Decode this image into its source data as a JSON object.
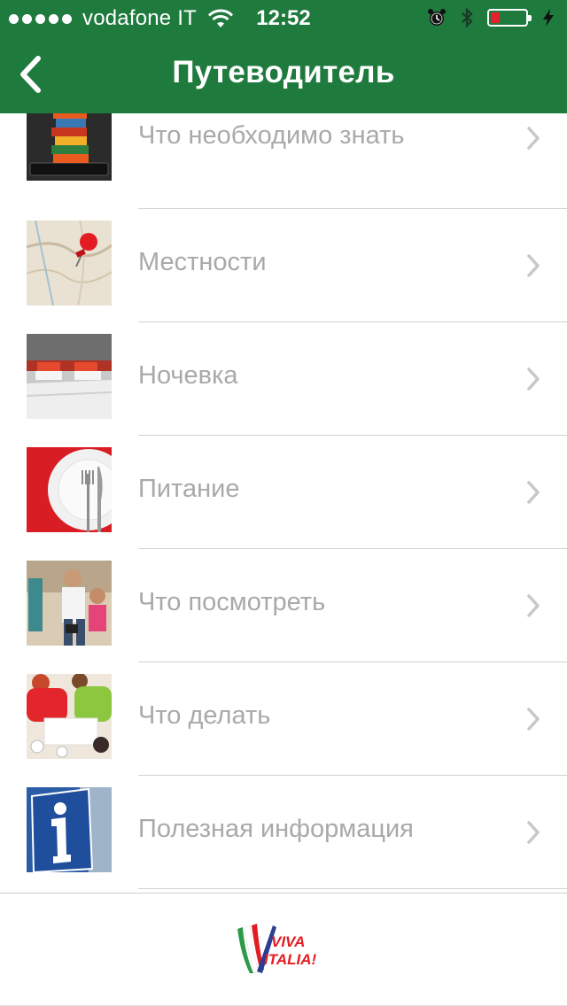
{
  "status_bar": {
    "carrier": "vodafone IT",
    "time": "12:52",
    "signal_icon": "signal-dots-icon",
    "wifi_icon": "wifi-icon",
    "alarm_icon": "alarm-icon",
    "bluetooth_icon": "bluetooth-icon",
    "battery_icon": "battery-low-icon",
    "charging_icon": "charging-bolt-icon",
    "battery_color": "#e8202a"
  },
  "nav": {
    "title": "Путеводитель",
    "back_icon": "chevron-left-icon",
    "color": "#1f7a3e"
  },
  "menu": {
    "items": [
      {
        "label": "Что необходимо знать",
        "icon": "books-stack-icon"
      },
      {
        "label": "Местности",
        "icon": "map-pin-icon"
      },
      {
        "label": "Ночевка",
        "icon": "hotel-bed-icon"
      },
      {
        "label": "Питание",
        "icon": "plate-fork-knife-icon"
      },
      {
        "label": "Что посмотреть",
        "icon": "tourists-photo-icon"
      },
      {
        "label": "Что делать",
        "icon": "people-activity-icon"
      },
      {
        "label": "Полезная информация",
        "icon": "info-sign-icon"
      }
    ],
    "chevron_icon": "chevron-right-icon"
  },
  "footer": {
    "logo_text_line1": "VIVA",
    "logo_text_line2": "ITALIA!",
    "logo_icon": "viva-italia-logo"
  }
}
